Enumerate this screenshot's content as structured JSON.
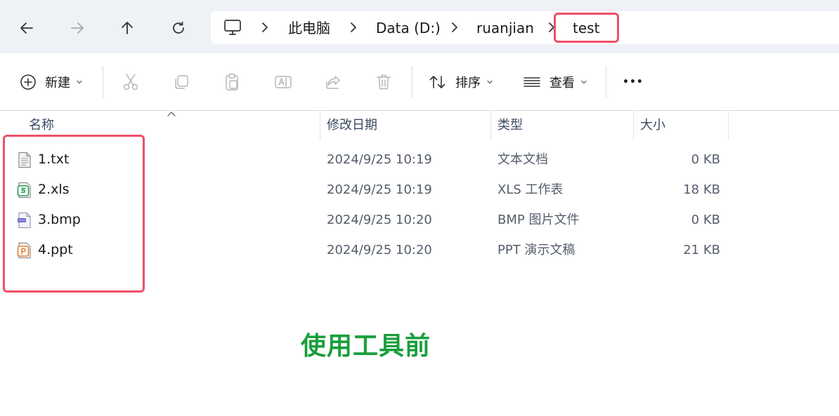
{
  "address_bar": {
    "crumbs": [
      "此电脑",
      "Data (D:)",
      "ruanjian",
      "test"
    ]
  },
  "toolbar": {
    "new_label": "新建",
    "sort_label": "排序",
    "view_label": "查看",
    "more_label": "•••"
  },
  "columns": {
    "name": "名称",
    "modified": "修改日期",
    "type": "类型",
    "size": "大小"
  },
  "files": [
    {
      "name": "1.txt",
      "modified": "2024/9/25 10:19",
      "type": "文本文档",
      "size": "0 KB",
      "icon": "text-file-icon"
    },
    {
      "name": "2.xls",
      "modified": "2024/9/25 10:19",
      "type": "XLS 工作表",
      "size": "18 KB",
      "icon": "spreadsheet-file-icon"
    },
    {
      "name": "3.bmp",
      "modified": "2024/9/25 10:20",
      "type": "BMP 图片文件",
      "size": "0 KB",
      "icon": "image-file-icon"
    },
    {
      "name": "4.ppt",
      "modified": "2024/9/25 10:20",
      "type": "PPT 演示文稿",
      "size": "21 KB",
      "icon": "presentation-file-icon"
    }
  ],
  "caption": "使用工具前",
  "colors": {
    "highlight": "#ef4f67",
    "caption": "#1a9e3c",
    "spreadsheet": "#1f9b4f",
    "presentation": "#e07a2c",
    "image": "#6a63c9"
  }
}
